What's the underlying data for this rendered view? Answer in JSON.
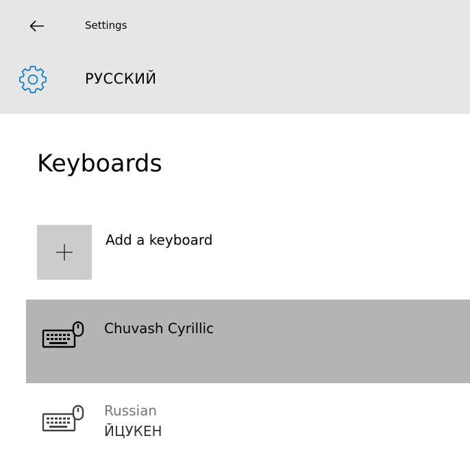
{
  "app": {
    "window_title": "Settings"
  },
  "page": {
    "title": "РУССКИЙ"
  },
  "keyboards": {
    "section_title": "Keyboards",
    "add_label": "Add a keyboard",
    "items": [
      {
        "name": "Chuvash Cyrillic",
        "layout": "",
        "selected": true
      },
      {
        "name": "Russian",
        "layout": "ЙЦУКЕН",
        "selected": false
      }
    ]
  },
  "icons": {
    "back": "back-arrow-icon",
    "settings": "gear-icon",
    "add": "plus-icon",
    "keyboard": "keyboard-icon"
  },
  "colors": {
    "header_bg": "#e6e6e6",
    "accent": "#0078d7",
    "selected_bg": "#b4b4b4",
    "tile_bg": "#cccccc",
    "secondary_text": "#767676"
  }
}
